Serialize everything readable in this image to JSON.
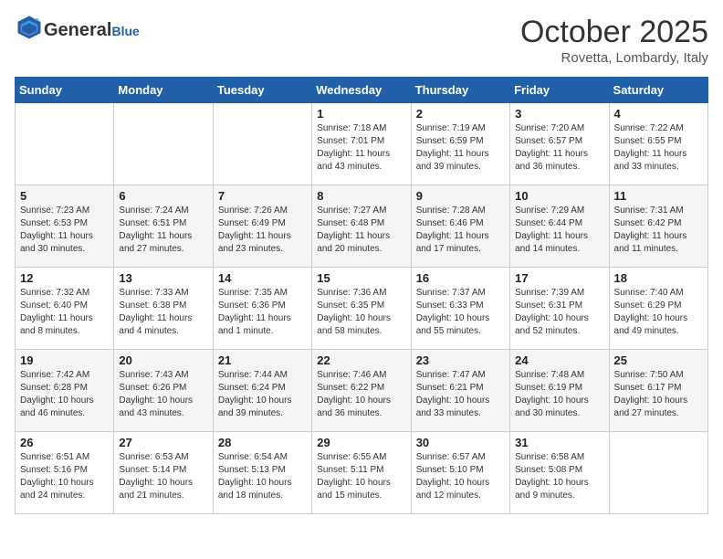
{
  "header": {
    "logo_line1": "General",
    "logo_line2": "Blue",
    "month": "October 2025",
    "location": "Rovetta, Lombardy, Italy"
  },
  "weekdays": [
    "Sunday",
    "Monday",
    "Tuesday",
    "Wednesday",
    "Thursday",
    "Friday",
    "Saturday"
  ],
  "weeks": [
    [
      {
        "day": "",
        "info": ""
      },
      {
        "day": "",
        "info": ""
      },
      {
        "day": "",
        "info": ""
      },
      {
        "day": "1",
        "info": "Sunrise: 7:18 AM\nSunset: 7:01 PM\nDaylight: 11 hours\nand 43 minutes."
      },
      {
        "day": "2",
        "info": "Sunrise: 7:19 AM\nSunset: 6:59 PM\nDaylight: 11 hours\nand 39 minutes."
      },
      {
        "day": "3",
        "info": "Sunrise: 7:20 AM\nSunset: 6:57 PM\nDaylight: 11 hours\nand 36 minutes."
      },
      {
        "day": "4",
        "info": "Sunrise: 7:22 AM\nSunset: 6:55 PM\nDaylight: 11 hours\nand 33 minutes."
      }
    ],
    [
      {
        "day": "5",
        "info": "Sunrise: 7:23 AM\nSunset: 6:53 PM\nDaylight: 11 hours\nand 30 minutes."
      },
      {
        "day": "6",
        "info": "Sunrise: 7:24 AM\nSunset: 6:51 PM\nDaylight: 11 hours\nand 27 minutes."
      },
      {
        "day": "7",
        "info": "Sunrise: 7:26 AM\nSunset: 6:49 PM\nDaylight: 11 hours\nand 23 minutes."
      },
      {
        "day": "8",
        "info": "Sunrise: 7:27 AM\nSunset: 6:48 PM\nDaylight: 11 hours\nand 20 minutes."
      },
      {
        "day": "9",
        "info": "Sunrise: 7:28 AM\nSunset: 6:46 PM\nDaylight: 11 hours\nand 17 minutes."
      },
      {
        "day": "10",
        "info": "Sunrise: 7:29 AM\nSunset: 6:44 PM\nDaylight: 11 hours\nand 14 minutes."
      },
      {
        "day": "11",
        "info": "Sunrise: 7:31 AM\nSunset: 6:42 PM\nDaylight: 11 hours\nand 11 minutes."
      }
    ],
    [
      {
        "day": "12",
        "info": "Sunrise: 7:32 AM\nSunset: 6:40 PM\nDaylight: 11 hours\nand 8 minutes."
      },
      {
        "day": "13",
        "info": "Sunrise: 7:33 AM\nSunset: 6:38 PM\nDaylight: 11 hours\nand 4 minutes."
      },
      {
        "day": "14",
        "info": "Sunrise: 7:35 AM\nSunset: 6:36 PM\nDaylight: 11 hours\nand 1 minute."
      },
      {
        "day": "15",
        "info": "Sunrise: 7:36 AM\nSunset: 6:35 PM\nDaylight: 10 hours\nand 58 minutes."
      },
      {
        "day": "16",
        "info": "Sunrise: 7:37 AM\nSunset: 6:33 PM\nDaylight: 10 hours\nand 55 minutes."
      },
      {
        "day": "17",
        "info": "Sunrise: 7:39 AM\nSunset: 6:31 PM\nDaylight: 10 hours\nand 52 minutes."
      },
      {
        "day": "18",
        "info": "Sunrise: 7:40 AM\nSunset: 6:29 PM\nDaylight: 10 hours\nand 49 minutes."
      }
    ],
    [
      {
        "day": "19",
        "info": "Sunrise: 7:42 AM\nSunset: 6:28 PM\nDaylight: 10 hours\nand 46 minutes."
      },
      {
        "day": "20",
        "info": "Sunrise: 7:43 AM\nSunset: 6:26 PM\nDaylight: 10 hours\nand 43 minutes."
      },
      {
        "day": "21",
        "info": "Sunrise: 7:44 AM\nSunset: 6:24 PM\nDaylight: 10 hours\nand 39 minutes."
      },
      {
        "day": "22",
        "info": "Sunrise: 7:46 AM\nSunset: 6:22 PM\nDaylight: 10 hours\nand 36 minutes."
      },
      {
        "day": "23",
        "info": "Sunrise: 7:47 AM\nSunset: 6:21 PM\nDaylight: 10 hours\nand 33 minutes."
      },
      {
        "day": "24",
        "info": "Sunrise: 7:48 AM\nSunset: 6:19 PM\nDaylight: 10 hours\nand 30 minutes."
      },
      {
        "day": "25",
        "info": "Sunrise: 7:50 AM\nSunset: 6:17 PM\nDaylight: 10 hours\nand 27 minutes."
      }
    ],
    [
      {
        "day": "26",
        "info": "Sunrise: 6:51 AM\nSunset: 5:16 PM\nDaylight: 10 hours\nand 24 minutes."
      },
      {
        "day": "27",
        "info": "Sunrise: 6:53 AM\nSunset: 5:14 PM\nDaylight: 10 hours\nand 21 minutes."
      },
      {
        "day": "28",
        "info": "Sunrise: 6:54 AM\nSunset: 5:13 PM\nDaylight: 10 hours\nand 18 minutes."
      },
      {
        "day": "29",
        "info": "Sunrise: 6:55 AM\nSunset: 5:11 PM\nDaylight: 10 hours\nand 15 minutes."
      },
      {
        "day": "30",
        "info": "Sunrise: 6:57 AM\nSunset: 5:10 PM\nDaylight: 10 hours\nand 12 minutes."
      },
      {
        "day": "31",
        "info": "Sunrise: 6:58 AM\nSunset: 5:08 PM\nDaylight: 10 hours\nand 9 minutes."
      },
      {
        "day": "",
        "info": ""
      }
    ]
  ]
}
